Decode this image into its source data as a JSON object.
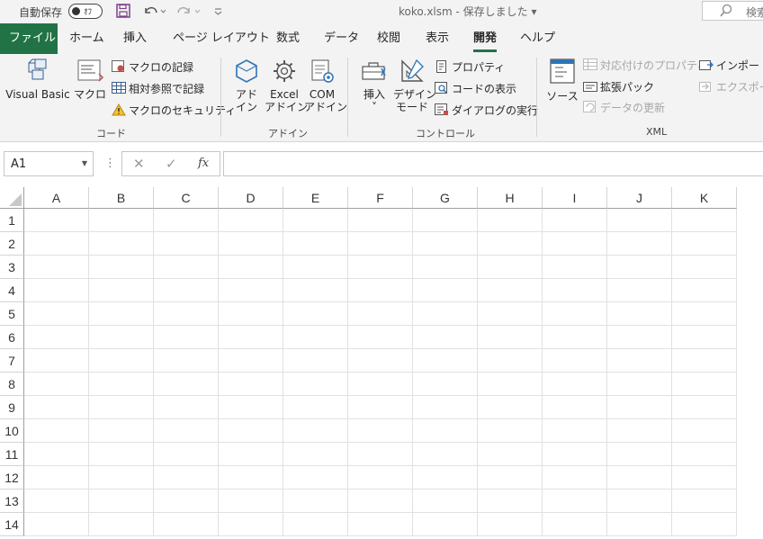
{
  "titlebar": {
    "autosave_label": "自動保存",
    "autosave_toggle": "ｵﾌ",
    "title": "koko.xlsm  -  保存しました  ▾",
    "search_placeholder": "検索"
  },
  "tabs": [
    "ファイル",
    "ホーム",
    "挿入",
    "ページ レイアウト",
    "数式",
    "データ",
    "校閲",
    "表示",
    "開発",
    "ヘルプ"
  ],
  "active_tab": "開発",
  "ribbon": {
    "code": {
      "label": "コード",
      "visual_basic": "Visual Basic",
      "macro": "マクロ",
      "record_macro": "マクロの記録",
      "relative_ref": "相対参照で記録",
      "macro_security": "マクロのセキュリティ"
    },
    "addins": {
      "label": "アドイン",
      "addin_1": "アド",
      "addin_2": "イン",
      "excel_1": "Excel",
      "excel_2": "アドイン",
      "com_1": "COM",
      "com_2": "アドイン"
    },
    "controls": {
      "label": "コントロール",
      "insert_1": "挿入",
      "insert_2": "˅",
      "design_1": "デザイン",
      "design_2": "モード",
      "properties": "プロパティ",
      "view_code": "コードの表示",
      "run_dialog": "ダイアログの実行"
    },
    "xml": {
      "label": "XML",
      "source": "ソース",
      "map_properties": "対応付けのプロパティ",
      "expansion_packs": "拡張パック",
      "refresh_data": "データの更新",
      "import": "インポート",
      "export": "エクスポート"
    }
  },
  "formula_bar": {
    "name_box": "A1",
    "fx": "fx",
    "formula": ""
  },
  "grid": {
    "columns": [
      "A",
      "B",
      "C",
      "D",
      "E",
      "F",
      "G",
      "H",
      "I",
      "J",
      "K"
    ],
    "rows": [
      "1",
      "2",
      "3",
      "4",
      "5",
      "6",
      "7",
      "8",
      "9",
      "10",
      "11",
      "12",
      "13",
      "14"
    ]
  },
  "colors": {
    "file_tab": "#217346",
    "active_underline": "#217346",
    "ribbon_bg": "#f3f3f3"
  }
}
